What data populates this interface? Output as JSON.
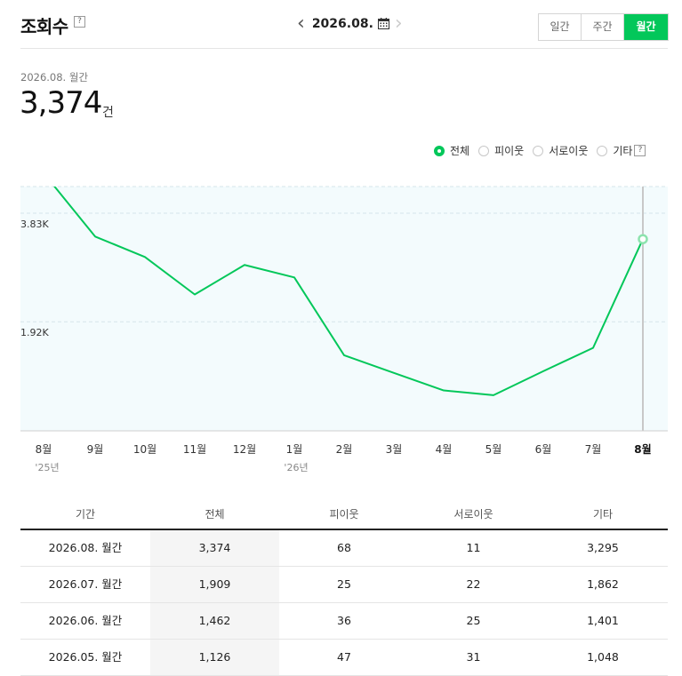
{
  "header": {
    "title": "조회수",
    "help": "?",
    "date": "2026.08.",
    "prev": "‹",
    "next": "›",
    "tabs": [
      {
        "label": "일간",
        "active": false
      },
      {
        "label": "주간",
        "active": false
      },
      {
        "label": "월간",
        "active": true
      }
    ]
  },
  "summary": {
    "period": "2026.08. 월간",
    "value": "3,374",
    "unit": "건"
  },
  "legend": [
    {
      "label": "전체",
      "checked": true
    },
    {
      "label": "피이웃",
      "checked": false
    },
    {
      "label": "서로이웃",
      "checked": false
    },
    {
      "label": "기타",
      "checked": false
    }
  ],
  "legend_help": "?",
  "colors": {
    "accent": "#03c75a",
    "plot_bg": "#f3fbfd"
  },
  "chart_data": {
    "type": "line",
    "categories": [
      "8월",
      "9월",
      "10월",
      "11월",
      "12월",
      "1월",
      "2월",
      "3월",
      "4월",
      "5월",
      "6월",
      "7월",
      "8월"
    ],
    "year_labels": {
      "0": "'25년",
      "5": "'26년"
    },
    "series": [
      {
        "values": [
          4500,
          3420,
          3060,
          2400,
          2920,
          2700,
          1330,
          1020,
          711,
          627,
          1050,
          1460,
          3374
        ]
      }
    ],
    "yticks": [
      {
        "value": 3830,
        "label": "3.83K"
      },
      {
        "value": 1920,
        "label": "1.92K"
      }
    ],
    "ylim": [
      0,
      4300
    ],
    "highlight_index": 12,
    "grid": true
  },
  "table": {
    "headers": [
      "기간",
      "전체",
      "피이웃",
      "서로이웃",
      "기타"
    ],
    "rows": [
      [
        "2026.08. 월간",
        "3,374",
        "68",
        "11",
        "3,295"
      ],
      [
        "2026.07. 월간",
        "1,909",
        "25",
        "22",
        "1,862"
      ],
      [
        "2026.06. 월간",
        "1,462",
        "36",
        "25",
        "1,401"
      ],
      [
        "2026.05. 월간",
        "1,126",
        "47",
        "31",
        "1,048"
      ]
    ]
  }
}
